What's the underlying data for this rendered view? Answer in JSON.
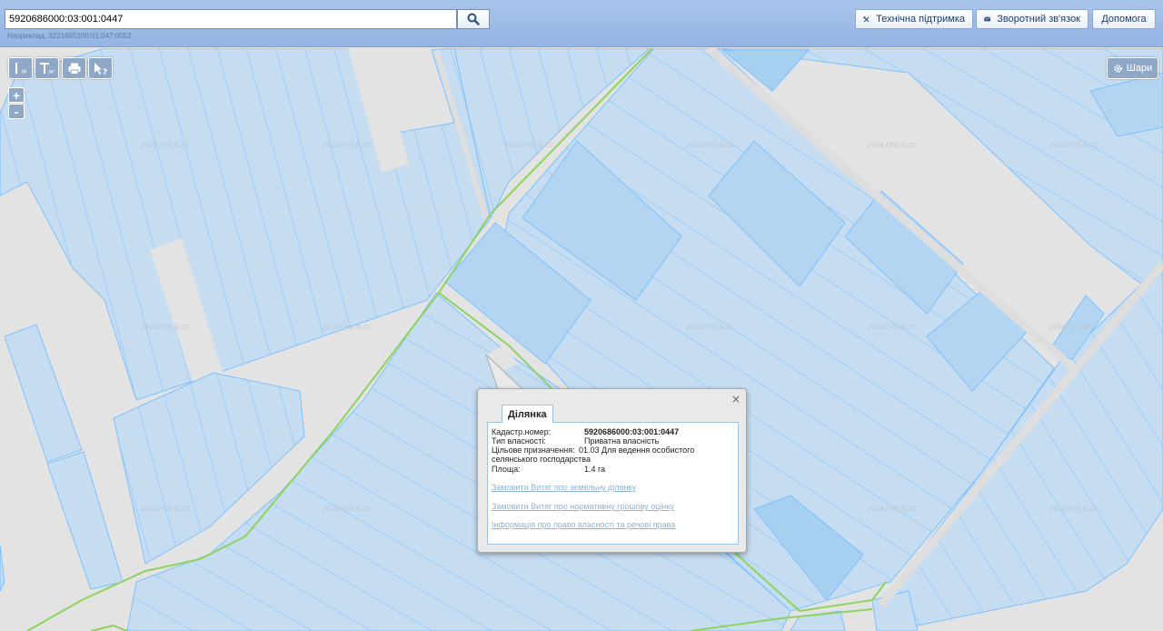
{
  "search": {
    "value": "5920686000:03:001:0447",
    "example": "Наприклад: 3221655100:01:047:0052"
  },
  "header_buttons": {
    "support": "Технічна підтримка",
    "feedback": "Зворотний зв'язок",
    "help": "Допомога"
  },
  "map_tools": {
    "zoom_in": "+",
    "zoom_out": "-",
    "layers": "Шари",
    "measure_line_label": "М",
    "measure_area_label": "М²"
  },
  "watermark": "2018 ГЕО.SLCC",
  "popup": {
    "close": "×",
    "tab": "Ділянка",
    "fields": [
      {
        "key": "Кадастр.номер:",
        "value": "5920686000:03:001:0447"
      },
      {
        "key": "Тип власності:",
        "value": "Приватна власність"
      },
      {
        "key": "Цільове призначення:",
        "value": "01.03 Для ведення особистого"
      },
      {
        "key": "Площа:",
        "value": "1.4 га"
      }
    ],
    "purpose_cont": "селянського господарства",
    "links": [
      "Замовити Витяг про земельну ділянку",
      "Замовити Витяг про нормативну грошову оцінку",
      "Інформація про право власності та речові права"
    ]
  },
  "colors": {
    "parcel_fill": "#c6dcf0",
    "parcel_stroke": "#7cc1ff",
    "highlight_fill": "#b4d5f1",
    "road": "#e3e3e3",
    "boundary": "#8dd35f"
  }
}
